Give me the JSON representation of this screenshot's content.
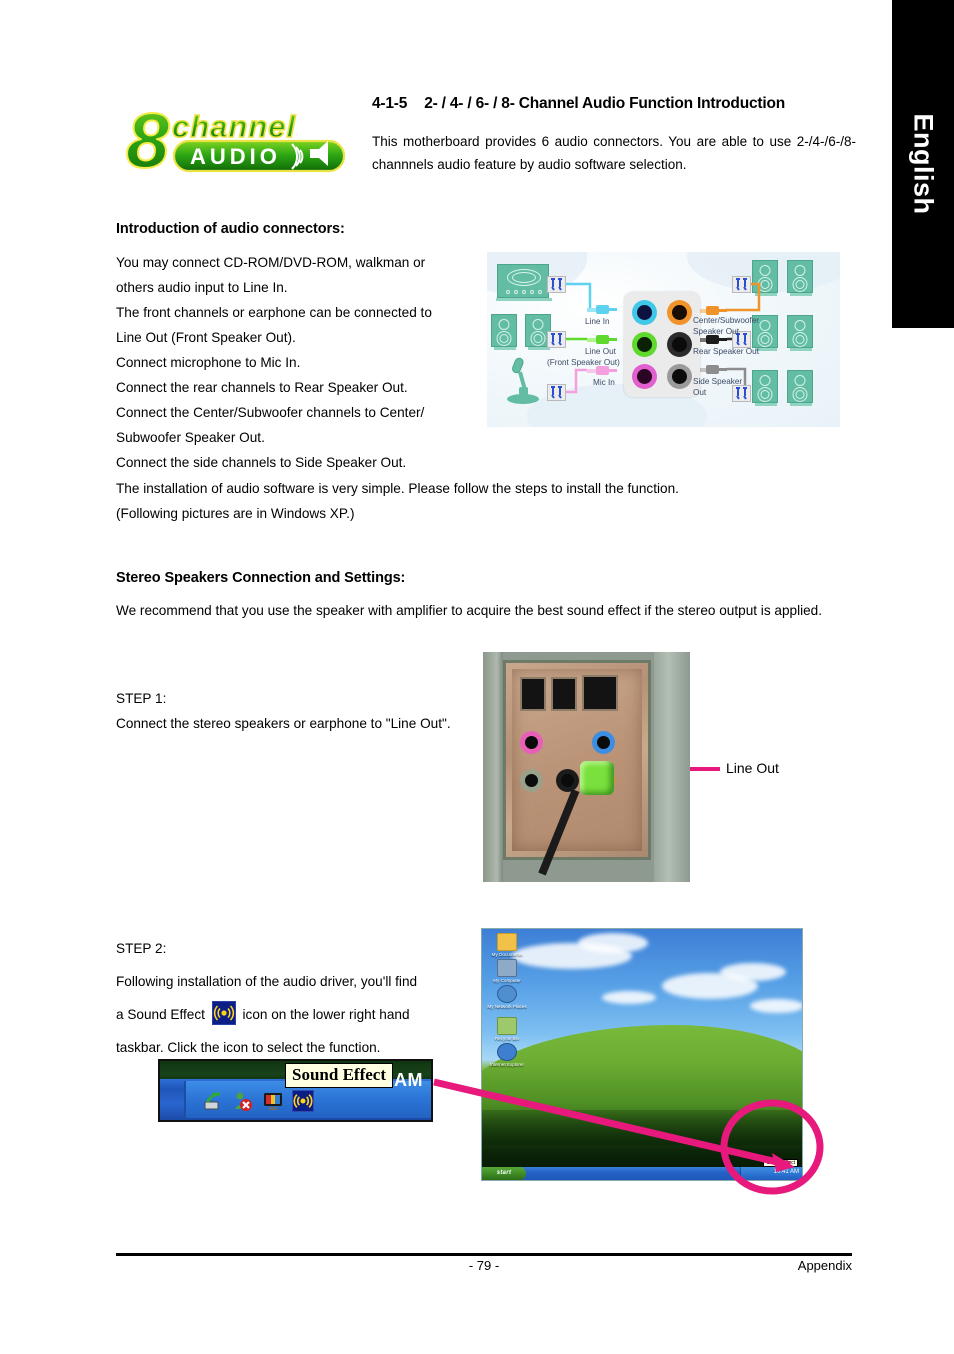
{
  "sidebar_tab": {
    "label": "English"
  },
  "header": {
    "section_number": "4-1-5",
    "title": "2- / 4- / 6- / 8- Channel Audio Function Introduction",
    "intro": "This motherboard provides 6 audio connectors. You are able to use 2-/4-/6-/8-channnels audio feature by audio software selection.",
    "logo": {
      "eight": "8",
      "channel": "CHANNEL",
      "audio": "AUDIO"
    }
  },
  "intro_section": {
    "heading": "Introduction of audio connectors:",
    "lines": [
      "You may connect CD-ROM/DVD-ROM, walkman or",
      "others audio input to Line In.",
      "The front channels or earphone can be connected to",
      "Line Out (Front Speaker Out).",
      "Connect microphone to Mic In.",
      "Connect the rear channels to Rear Speaker Out.",
      "Connect the Center/Subwoofer channels to Center/",
      "Subwoofer Speaker Out.",
      "Connect the side channels to Side Speaker Out."
    ],
    "full_width_lines": [
      "The installation of audio software is very simple. Please follow the steps to install the function.",
      "(Following pictures are in Windows XP.)"
    ]
  },
  "connector_diagram": {
    "jacks": [
      {
        "name": "Line In",
        "color": "#3fc8e8",
        "inner": "#0d1240",
        "label": "Line In"
      },
      {
        "name": "Center/Subwoofer",
        "color": "#f0932a",
        "inner": "#170d03",
        "label": "Center/Subwoofer\nSpeaker Out"
      },
      {
        "name": "Line Out",
        "color": "#5fd92e",
        "inner": "#0a2104",
        "label": "Line Out\n(Front Speaker Out)"
      },
      {
        "name": "Rear Speaker Out",
        "color": "#2b2b2b",
        "inner": "#0b0b0b",
        "label": "Rear Speaker Out"
      },
      {
        "name": "Mic In",
        "color": "#e25fd0",
        "inner": "#2b0624",
        "label": "Mic In"
      },
      {
        "name": "Side Speaker Out",
        "color": "#9a9a9a",
        "inner": "#0b0b0b",
        "label": "Side Speaker\nOut"
      }
    ],
    "labels": {
      "line_in": "Line In",
      "line_out": "Line Out",
      "line_out_sub": "(Front Speaker Out)",
      "mic_in": "Mic In",
      "center_sub_1": "Center/Subwoofer",
      "center_sub_2": "Speaker Out",
      "rear": "Rear Speaker Out",
      "side_1": "Side Speaker",
      "side_2": "Out"
    }
  },
  "stereo_section": {
    "heading": "Stereo Speakers Connection and Settings:",
    "body": "We recommend that you use the speaker with amplifier to acquire the best sound effect if the stereo output is applied."
  },
  "step1": {
    "label": "STEP 1:",
    "text": "Connect the stereo speakers or earphone to \"Line Out\".",
    "callout": "Line Out"
  },
  "step2": {
    "label": "STEP 2:",
    "line1": "Following installation of the audio driver, you'll find",
    "line2_a": "a Sound Effect",
    "line2_b": "icon on the lower right hand",
    "line3": "taskbar.  Click the icon to select the function.",
    "icon_name": "sound-effect-icon"
  },
  "taskbar_zoom": {
    "tooltip": "Sound Effect",
    "clock": "10:41 AM",
    "tray_icons": [
      "network-icon",
      "user-account-error-icon",
      "display-icon",
      "sound-effect-icon"
    ]
  },
  "xp_desktop": {
    "start_label": "start",
    "clock": "10:41 AM",
    "tooltip": "Sound Effect",
    "icons": [
      {
        "label": "My Documents",
        "color": "#f2c14a"
      },
      {
        "label": "My Computer",
        "color": "#8fa9c8"
      },
      {
        "label": "My Network Places",
        "color": "#4f8fd0"
      },
      {
        "label": "Recycle Bin",
        "color": "#9ec96a"
      },
      {
        "label": "Internet Explorer",
        "color": "#3f7fd0"
      }
    ]
  },
  "footer": {
    "page_number": "- 79 -",
    "section": "Appendix"
  },
  "colors": {
    "annotation_pink": "#e8197d",
    "tab_black": "#000000",
    "logo_green": "#1e9e14",
    "logo_yellow": "#f2e400"
  }
}
